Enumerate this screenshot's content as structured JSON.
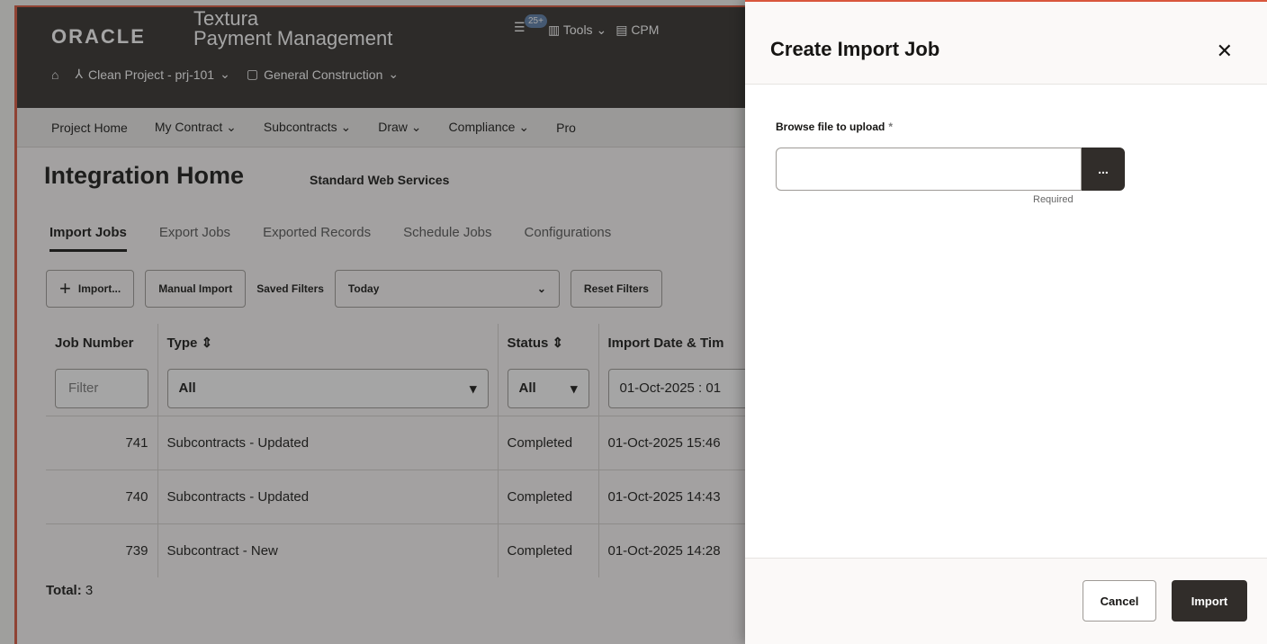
{
  "header": {
    "logo": "ORACLE",
    "product_line1": "Textura",
    "product_line2": "Payment Management",
    "notifications_badge": "25+",
    "tools_label": "Tools",
    "cpm_label": "CPM",
    "project_label": "Clean Project - prj-101",
    "trade_label": "General Construction"
  },
  "menu": {
    "items": [
      "Project Home",
      "My Contract",
      "Subcontracts",
      "Draw",
      "Compliance",
      "Pro"
    ]
  },
  "page": {
    "title": "Integration Home",
    "subtitle": "Standard Web Services"
  },
  "tabs": [
    "Import Jobs",
    "Export Jobs",
    "Exported Records",
    "Schedule Jobs",
    "Configurations"
  ],
  "toolbar": {
    "import_label": "Import...",
    "manual_import_label": "Manual Import",
    "saved_filters_label": "Saved Filters",
    "saved_filter_value": "Today",
    "reset_filters_label": "Reset Filters"
  },
  "table": {
    "columns": [
      "Job Number",
      "Type",
      "Status",
      "Import Date & Tim"
    ],
    "filters": {
      "job_number_placeholder": "Filter",
      "type_value": "All",
      "status_value": "All",
      "date_value": "01-Oct-2025 : 01"
    },
    "rows": [
      {
        "job": "741",
        "type": "Subcontracts - Updated",
        "status": "Completed",
        "date": "01-Oct-2025 15:46"
      },
      {
        "job": "740",
        "type": "Subcontracts - Updated",
        "status": "Completed",
        "date": "01-Oct-2025 14:43"
      },
      {
        "job": "739",
        "type": "Subcontract - New",
        "status": "Completed",
        "date": "01-Oct-2025 14:28"
      }
    ],
    "total_label": "Total:",
    "total_value": "3"
  },
  "drawer": {
    "title": "Create Import Job",
    "field_label": "Browse file to upload",
    "required_star": "*",
    "browse_label": "...",
    "required_text": "Required",
    "cancel_label": "Cancel",
    "import_label": "Import"
  }
}
